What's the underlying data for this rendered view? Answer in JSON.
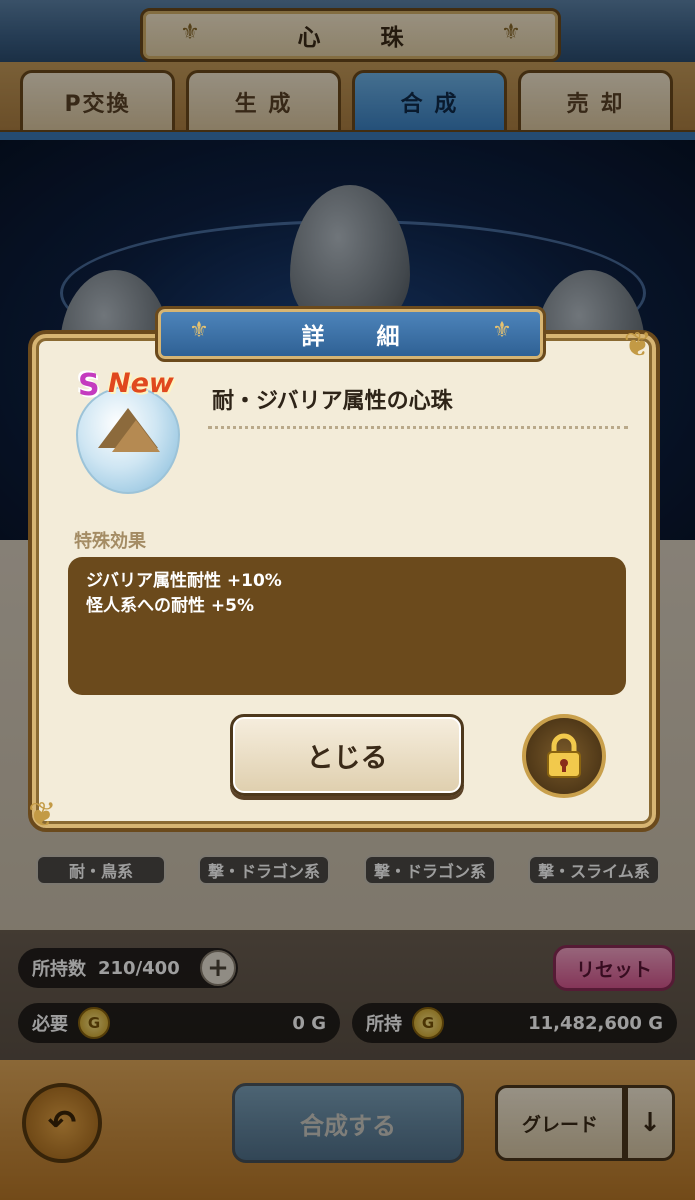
{
  "header": {
    "title": "心 珠"
  },
  "tabs": [
    {
      "label": "P交換",
      "active": false
    },
    {
      "label": "生 成",
      "active": false
    },
    {
      "label": "合 成",
      "active": true
    },
    {
      "label": "売 却",
      "active": false
    }
  ],
  "background_items": [
    {
      "label": "耐・鳥系"
    },
    {
      "label": "撃・ドラゴン系"
    },
    {
      "label": "撃・ドラゴン系"
    },
    {
      "label": "撃・スライム系"
    }
  ],
  "footer": {
    "owned_label": "所持数",
    "owned_value": "210/400",
    "reset_label": "リセット",
    "required_label": "必要",
    "required_value": "0 G",
    "gold_label": "所持",
    "gold_value": "11,482,600 G",
    "combine_label": "合成する",
    "grade_label": "グレード",
    "sort_arrow": "↓"
  },
  "dialog": {
    "title": "詳 細",
    "rank": "S",
    "new_badge": "New",
    "item_name": "耐・ジバリア属性の心珠",
    "section_label": "特殊効果",
    "effects": [
      "ジバリア属性耐性 +10%",
      "怪人系への耐性 +5%"
    ],
    "close_label": "とじる"
  },
  "colors": {
    "frame_brown": "#6b4a1c",
    "active_tab_blue": "#3c82c4",
    "effect_box": "#6b4a1c"
  },
  "icons": [
    "lock-icon",
    "back-arrow-icon",
    "plus-icon",
    "gold-coin-icon",
    "pyramid-icon"
  ]
}
